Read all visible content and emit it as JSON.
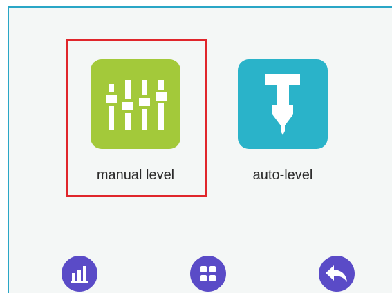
{
  "menu": {
    "items": [
      {
        "label": "manual level",
        "icon": "sliders-icon",
        "color": "#a3c93a",
        "selected": true
      },
      {
        "label": "auto-level",
        "icon": "nozzle-probe-icon",
        "color": "#2ab3c9",
        "selected": false
      }
    ]
  },
  "nav": {
    "buttons": [
      {
        "icon": "bar-chart-icon"
      },
      {
        "icon": "grid-icon"
      },
      {
        "icon": "back-arrow-icon"
      }
    ]
  },
  "colors": {
    "selection": "#e0262b",
    "nav": "#5a4bc7"
  }
}
